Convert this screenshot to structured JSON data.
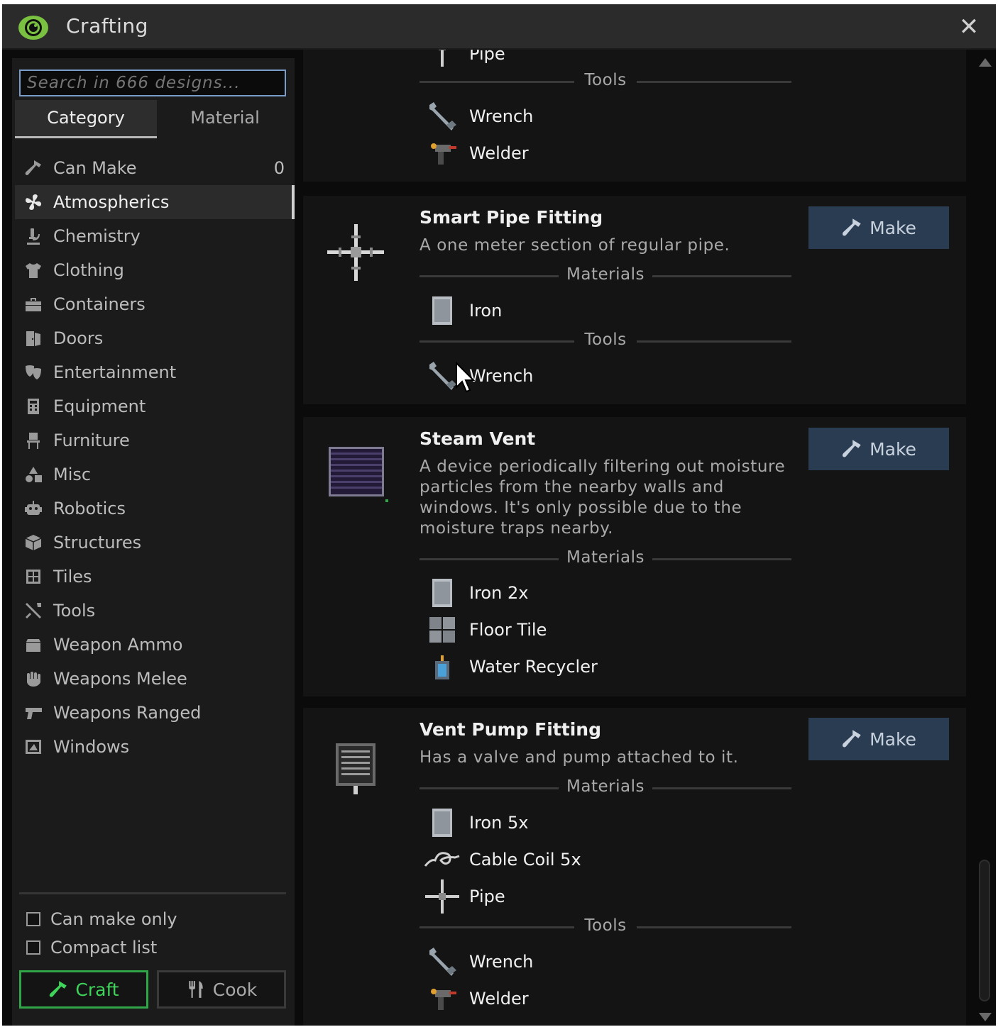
{
  "window": {
    "title": "Crafting",
    "close_label": "✕"
  },
  "search": {
    "placeholder": "Search in 666 designs..."
  },
  "tabs": [
    {
      "label": "Category"
    },
    {
      "label": "Material"
    }
  ],
  "categories": [
    {
      "label": "Can Make",
      "count": "0",
      "icon": "hammer-icon"
    },
    {
      "label": "Atmospherics",
      "icon": "fan-icon"
    },
    {
      "label": "Chemistry",
      "icon": "microscope-icon"
    },
    {
      "label": "Clothing",
      "icon": "shirt-icon"
    },
    {
      "label": "Containers",
      "icon": "briefcase-icon"
    },
    {
      "label": "Doors",
      "icon": "door-icon"
    },
    {
      "label": "Entertainment",
      "icon": "masks-icon"
    },
    {
      "label": "Equipment",
      "icon": "calculator-icon"
    },
    {
      "label": "Furniture",
      "icon": "chair-icon"
    },
    {
      "label": "Misc",
      "icon": "shapes-icon"
    },
    {
      "label": "Robotics",
      "icon": "robot-icon"
    },
    {
      "label": "Structures",
      "icon": "cube-icon"
    },
    {
      "label": "Tiles",
      "icon": "grid-icon"
    },
    {
      "label": "Tools",
      "icon": "tools-icon"
    },
    {
      "label": "Weapon Ammo",
      "icon": "ammo-box-icon"
    },
    {
      "label": "Weapons Melee",
      "icon": "fist-icon"
    },
    {
      "label": "Weapons Ranged",
      "icon": "gun-icon"
    },
    {
      "label": "Windows",
      "icon": "window-icon"
    }
  ],
  "selected_category": "Atmospherics",
  "options": {
    "can_make_only": "Can make only",
    "compact_list": "Compact list"
  },
  "buttons": {
    "craft": "Craft",
    "cook": "Cook",
    "make": "Make"
  },
  "recipes": {
    "partial": {
      "cut_item": "Pipe",
      "tools_label": "Tools",
      "tools": [
        "Wrench",
        "Welder"
      ]
    },
    "smart_pipe": {
      "name": "Smart Pipe Fitting",
      "desc": "A one meter section of regular pipe.",
      "materials_label": "Materials",
      "materials": [
        "Iron"
      ],
      "tools_label": "Tools",
      "tools": [
        "Wrench"
      ]
    },
    "steam_vent": {
      "name": "Steam Vent",
      "desc_lines": [
        "A device periodically filtering out moisture",
        "particles from the nearby walls and",
        "windows. It's only possible due to the",
        "moisture traps nearby."
      ],
      "materials_label": "Materials",
      "materials": [
        "Iron 2x",
        "Floor Tile",
        "Water Recycler"
      ]
    },
    "vent_pump": {
      "name": "Vent Pump Fitting",
      "desc": "Has a valve and pump attached to it.",
      "materials_label": "Materials",
      "materials": [
        "Iron 5x",
        "Cable Coil 5x",
        "Pipe"
      ],
      "tools_label": "Tools",
      "tools": [
        "Wrench",
        "Welder"
      ]
    }
  },
  "colors": {
    "accent_green": "#3fd35a",
    "make_button": "#2a3c52",
    "search_border": "#7a9cc8"
  }
}
